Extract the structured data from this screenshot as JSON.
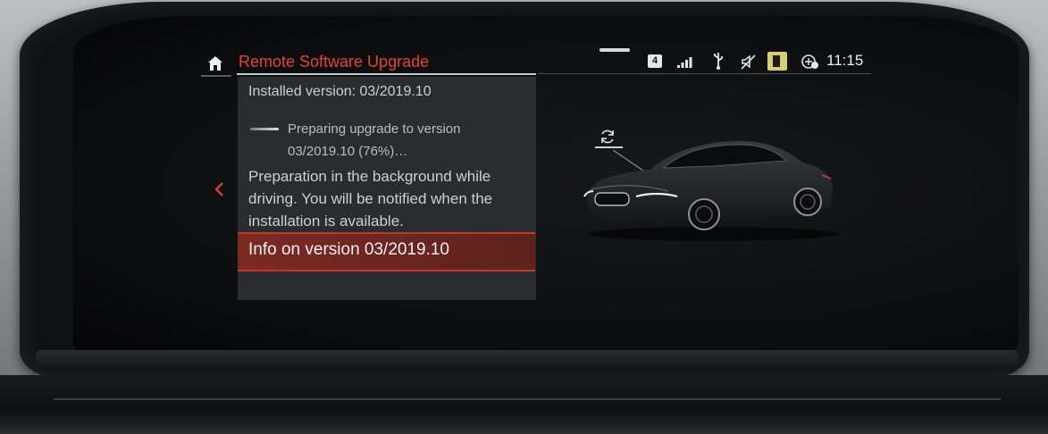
{
  "header": {
    "title": "Remote Software Upgrade",
    "home_icon": "home-icon"
  },
  "status_bar": {
    "badge": "4",
    "icons": [
      "signal-strength-icon",
      "usb-icon",
      "mute-icon",
      "sim-card-icon",
      "connected-drive-icon"
    ],
    "time": "11:15"
  },
  "upgrade_panel": {
    "installed_version": "Installed version: 03/2019.10",
    "preparing_line1": "Preparing upgrade to version",
    "preparing_line2": "03/2019.10 (76%)…",
    "progress_percent": 76,
    "description": "Preparation in the background while driving. You will be notified when the installation is available.",
    "info_button": "Info on version 03/2019.10"
  },
  "colors": {
    "accent": "#e8432e",
    "selected_row": "#6a2520",
    "panel_bg": "#2b2c2f"
  }
}
